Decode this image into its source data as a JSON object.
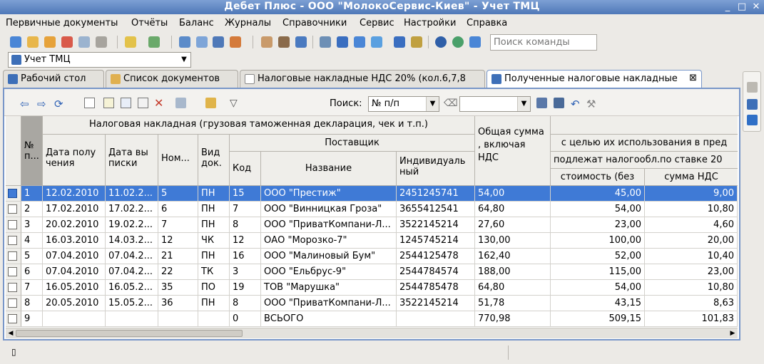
{
  "window": {
    "title": "Дебет Плюс - ООО \"МолокоСервис-Киев\" - Учет ТМЦ"
  },
  "menu": [
    "Первичные документы",
    "Отчёты",
    "Баланс",
    "Журналы",
    "Справочники",
    "Сервис",
    "Настройки",
    "Справка"
  ],
  "toolbar": {
    "search_placeholder": "Поиск команды"
  },
  "config": {
    "value": "Учет ТМЦ"
  },
  "tabs": [
    {
      "label": "Рабочий стол"
    },
    {
      "label": "Список документов"
    },
    {
      "label": "Налоговые накладные НДС 20% (кол.6,7,8"
    },
    {
      "label": "Полученные налоговые накладные"
    }
  ],
  "inner_toolbar": {
    "search_label": "Поиск:",
    "search_field": "№ п/п",
    "search_value": ""
  },
  "table": {
    "group_headers": {
      "invoice": "Налоговая накладная (грузовая таможенная декларация, чек и т.п.)",
      "supplier": "Поставщик",
      "total": "Общая сумма , включая НДС",
      "purpose": "с целью их использования в пред",
      "taxable": "подлежат налогообл.по ставке 20"
    },
    "columns": {
      "num": "№ п...",
      "date_received": "Дата полу чения",
      "date_issued": "Дата вы писки",
      "number": "Ном...",
      "doc_type": "Вид док.",
      "code": "Код",
      "name": "Название",
      "inn": "Индивидуаль ный",
      "cost": "стоимость (без",
      "vat": "сумма НДС"
    },
    "rows": [
      {
        "num": "1",
        "date_received": "12.02.2010",
        "date_issued": "11.02.2...",
        "number": "5",
        "doc_type": "ПН",
        "code": "15",
        "name": "ООО \"Престиж\"",
        "inn": "2451245741",
        "total": "54,00",
        "cost": "45,00",
        "vat": "9,00"
      },
      {
        "num": "2",
        "date_received": "17.02.2010",
        "date_issued": "17.02.2...",
        "number": "6",
        "doc_type": "ПН",
        "code": "7",
        "name": "ООО \"Винницкая Гроза\"",
        "inn": "3655412541",
        "total": "64,80",
        "cost": "54,00",
        "vat": "10,80"
      },
      {
        "num": "3",
        "date_received": "20.02.2010",
        "date_issued": "19.02.2...",
        "number": "7",
        "doc_type": "ПН",
        "code": "8",
        "name": "ООО \"ПриватКомпани-Л...",
        "inn": "3522145214",
        "total": "27,60",
        "cost": "23,00",
        "vat": "4,60"
      },
      {
        "num": "4",
        "date_received": "16.03.2010",
        "date_issued": "14.03.2...",
        "number": "12",
        "doc_type": "ЧК",
        "code": "12",
        "name": "ОАО \"Морозко-7\"",
        "inn": "1245745214",
        "total": "130,00",
        "cost": "100,00",
        "vat": "20,00"
      },
      {
        "num": "5",
        "date_received": "07.04.2010",
        "date_issued": "07.04.2...",
        "number": "21",
        "doc_type": "ПН",
        "code": "16",
        "name": "ООО \"Малиновый Бум\"",
        "inn": "2544125478",
        "total": "162,40",
        "cost": "52,00",
        "vat": "10,40"
      },
      {
        "num": "6",
        "date_received": "07.04.2010",
        "date_issued": "07.04.2...",
        "number": "22",
        "doc_type": "ТК",
        "code": "3",
        "name": "ООО \"Ельбрус-9\"",
        "inn": "2544784574",
        "total": "188,00",
        "cost": "115,00",
        "vat": "23,00"
      },
      {
        "num": "7",
        "date_received": "16.05.2010",
        "date_issued": "16.05.2...",
        "number": "35",
        "doc_type": "ПО",
        "code": "19",
        "name": "ТОВ \"Марушка\"",
        "inn": "2544785478",
        "total": "64,80",
        "cost": "54,00",
        "vat": "10,80"
      },
      {
        "num": "8",
        "date_received": "20.05.2010",
        "date_issued": "15.05.2...",
        "number": "36",
        "doc_type": "ПН",
        "code": "8",
        "name": "ООО \"ПриватКомпани-Л...",
        "inn": "3522145214",
        "total": "51,78",
        "cost": "43,15",
        "vat": "8,63"
      },
      {
        "num": "9",
        "date_received": "",
        "date_issued": "",
        "number": "",
        "doc_type": "",
        "code": "0",
        "name": "ВСЬОГО",
        "inn": "",
        "total": "770,98",
        "cost": "509,15",
        "vat": "101,83"
      }
    ],
    "selected_row": 0
  },
  "colors": {
    "selection": "#3f7ad6",
    "active_tab_border": "#7896c8",
    "titlebar": "#5b82c0"
  }
}
